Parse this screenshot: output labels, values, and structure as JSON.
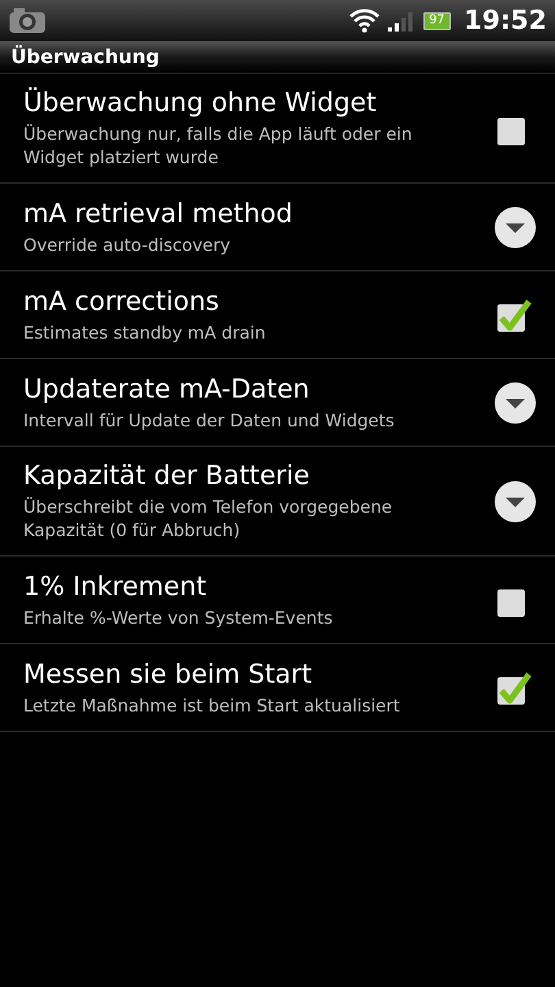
{
  "status_bar": {
    "battery": "97",
    "time": "19:52"
  },
  "category": "Überwachung",
  "settings": [
    {
      "kind": "checkbox",
      "title": "Überwachung ohne Widget",
      "summary": "Überwachung nur, falls die App läuft oder ein Widget platziert wurde",
      "checked": false
    },
    {
      "kind": "dropdown",
      "title": "mA retrieval method",
      "summary": "Override auto-discovery"
    },
    {
      "kind": "checkbox",
      "title": "mA corrections",
      "summary": "Estimates standby mA drain",
      "checked": true
    },
    {
      "kind": "dropdown",
      "title": "Updaterate mA-Daten",
      "summary": "Intervall für Update der Daten und Widgets"
    },
    {
      "kind": "dropdown",
      "title": "Kapazität der Batterie",
      "summary": "Überschreibt die vom Telefon vorgegebene Kapazität (0 für Abbruch)"
    },
    {
      "kind": "checkbox",
      "title": "1% Inkrement",
      "summary": "Erhalte %-Werte von System-Events",
      "checked": false
    },
    {
      "kind": "checkbox",
      "title": "Messen sie beim Start",
      "summary": "Letzte Maßnahme ist beim Start aktualisiert",
      "checked": true
    }
  ]
}
